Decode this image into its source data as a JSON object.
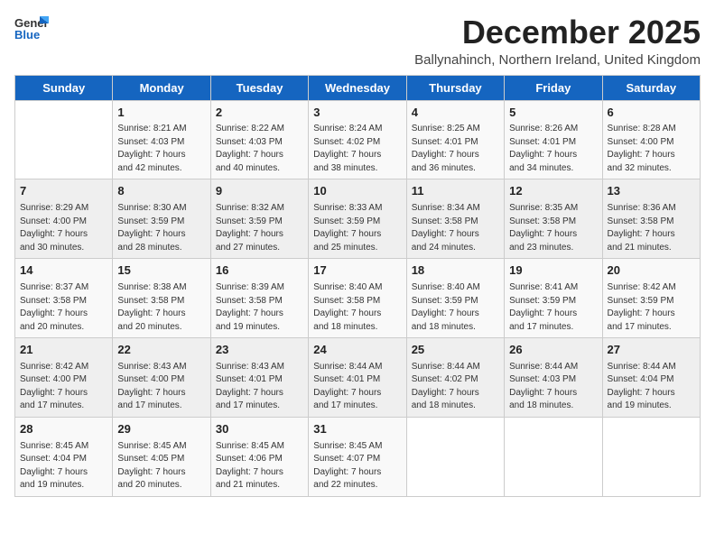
{
  "header": {
    "logo_line1": "General",
    "logo_line2": "Blue",
    "month_title": "December 2025",
    "subtitle": "Ballynahinch, Northern Ireland, United Kingdom"
  },
  "weekdays": [
    "Sunday",
    "Monday",
    "Tuesday",
    "Wednesday",
    "Thursday",
    "Friday",
    "Saturday"
  ],
  "weeks": [
    [
      {
        "day": "",
        "info": ""
      },
      {
        "day": "1",
        "info": "Sunrise: 8:21 AM\nSunset: 4:03 PM\nDaylight: 7 hours\nand 42 minutes."
      },
      {
        "day": "2",
        "info": "Sunrise: 8:22 AM\nSunset: 4:03 PM\nDaylight: 7 hours\nand 40 minutes."
      },
      {
        "day": "3",
        "info": "Sunrise: 8:24 AM\nSunset: 4:02 PM\nDaylight: 7 hours\nand 38 minutes."
      },
      {
        "day": "4",
        "info": "Sunrise: 8:25 AM\nSunset: 4:01 PM\nDaylight: 7 hours\nand 36 minutes."
      },
      {
        "day": "5",
        "info": "Sunrise: 8:26 AM\nSunset: 4:01 PM\nDaylight: 7 hours\nand 34 minutes."
      },
      {
        "day": "6",
        "info": "Sunrise: 8:28 AM\nSunset: 4:00 PM\nDaylight: 7 hours\nand 32 minutes."
      }
    ],
    [
      {
        "day": "7",
        "info": "Sunrise: 8:29 AM\nSunset: 4:00 PM\nDaylight: 7 hours\nand 30 minutes."
      },
      {
        "day": "8",
        "info": "Sunrise: 8:30 AM\nSunset: 3:59 PM\nDaylight: 7 hours\nand 28 minutes."
      },
      {
        "day": "9",
        "info": "Sunrise: 8:32 AM\nSunset: 3:59 PM\nDaylight: 7 hours\nand 27 minutes."
      },
      {
        "day": "10",
        "info": "Sunrise: 8:33 AM\nSunset: 3:59 PM\nDaylight: 7 hours\nand 25 minutes."
      },
      {
        "day": "11",
        "info": "Sunrise: 8:34 AM\nSunset: 3:58 PM\nDaylight: 7 hours\nand 24 minutes."
      },
      {
        "day": "12",
        "info": "Sunrise: 8:35 AM\nSunset: 3:58 PM\nDaylight: 7 hours\nand 23 minutes."
      },
      {
        "day": "13",
        "info": "Sunrise: 8:36 AM\nSunset: 3:58 PM\nDaylight: 7 hours\nand 21 minutes."
      }
    ],
    [
      {
        "day": "14",
        "info": "Sunrise: 8:37 AM\nSunset: 3:58 PM\nDaylight: 7 hours\nand 20 minutes."
      },
      {
        "day": "15",
        "info": "Sunrise: 8:38 AM\nSunset: 3:58 PM\nDaylight: 7 hours\nand 20 minutes."
      },
      {
        "day": "16",
        "info": "Sunrise: 8:39 AM\nSunset: 3:58 PM\nDaylight: 7 hours\nand 19 minutes."
      },
      {
        "day": "17",
        "info": "Sunrise: 8:40 AM\nSunset: 3:58 PM\nDaylight: 7 hours\nand 18 minutes."
      },
      {
        "day": "18",
        "info": "Sunrise: 8:40 AM\nSunset: 3:59 PM\nDaylight: 7 hours\nand 18 minutes."
      },
      {
        "day": "19",
        "info": "Sunrise: 8:41 AM\nSunset: 3:59 PM\nDaylight: 7 hours\nand 17 minutes."
      },
      {
        "day": "20",
        "info": "Sunrise: 8:42 AM\nSunset: 3:59 PM\nDaylight: 7 hours\nand 17 minutes."
      }
    ],
    [
      {
        "day": "21",
        "info": "Sunrise: 8:42 AM\nSunset: 4:00 PM\nDaylight: 7 hours\nand 17 minutes."
      },
      {
        "day": "22",
        "info": "Sunrise: 8:43 AM\nSunset: 4:00 PM\nDaylight: 7 hours\nand 17 minutes."
      },
      {
        "day": "23",
        "info": "Sunrise: 8:43 AM\nSunset: 4:01 PM\nDaylight: 7 hours\nand 17 minutes."
      },
      {
        "day": "24",
        "info": "Sunrise: 8:44 AM\nSunset: 4:01 PM\nDaylight: 7 hours\nand 17 minutes."
      },
      {
        "day": "25",
        "info": "Sunrise: 8:44 AM\nSunset: 4:02 PM\nDaylight: 7 hours\nand 18 minutes."
      },
      {
        "day": "26",
        "info": "Sunrise: 8:44 AM\nSunset: 4:03 PM\nDaylight: 7 hours\nand 18 minutes."
      },
      {
        "day": "27",
        "info": "Sunrise: 8:44 AM\nSunset: 4:04 PM\nDaylight: 7 hours\nand 19 minutes."
      }
    ],
    [
      {
        "day": "28",
        "info": "Sunrise: 8:45 AM\nSunset: 4:04 PM\nDaylight: 7 hours\nand 19 minutes."
      },
      {
        "day": "29",
        "info": "Sunrise: 8:45 AM\nSunset: 4:05 PM\nDaylight: 7 hours\nand 20 minutes."
      },
      {
        "day": "30",
        "info": "Sunrise: 8:45 AM\nSunset: 4:06 PM\nDaylight: 7 hours\nand 21 minutes."
      },
      {
        "day": "31",
        "info": "Sunrise: 8:45 AM\nSunset: 4:07 PM\nDaylight: 7 hours\nand 22 minutes."
      },
      {
        "day": "",
        "info": ""
      },
      {
        "day": "",
        "info": ""
      },
      {
        "day": "",
        "info": ""
      }
    ]
  ]
}
